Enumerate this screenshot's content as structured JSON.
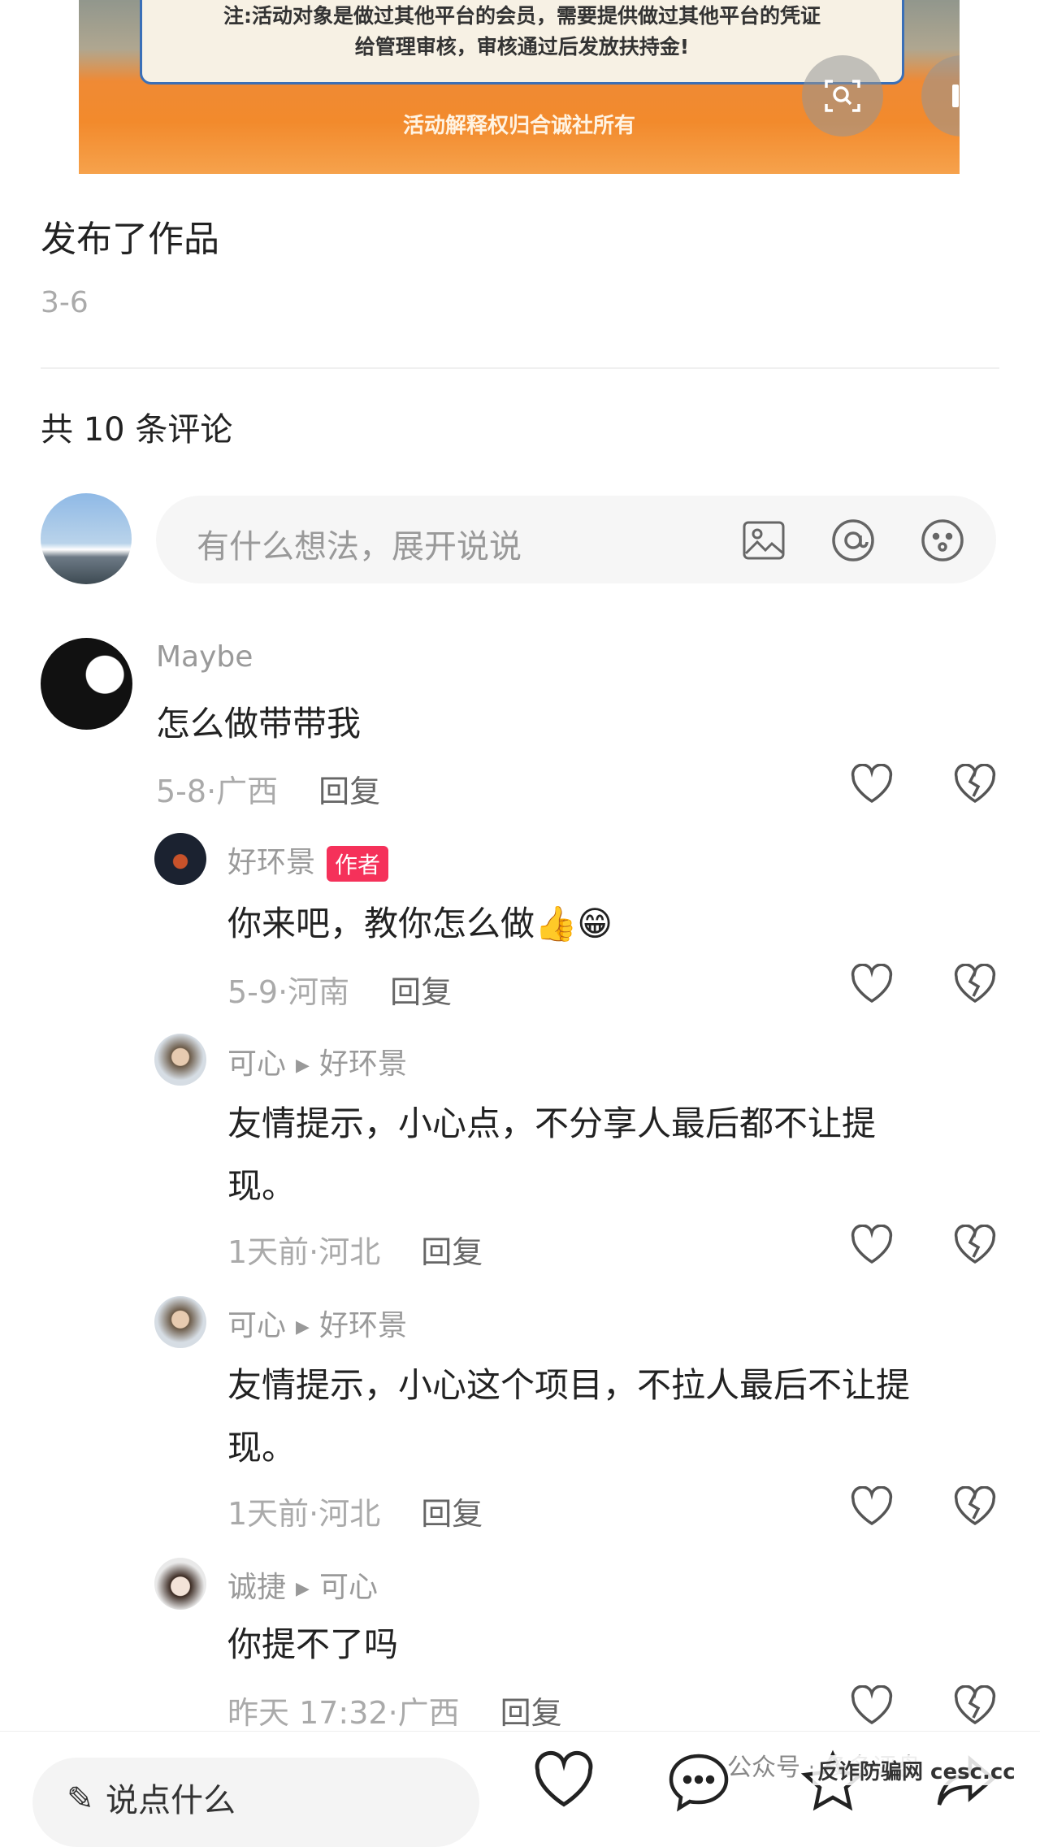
{
  "banner": {
    "notice_line1": "注:活动对象是做过其他平台的会员，需要提供做过其他平台的凭证",
    "notice_line2": "给管理审核，审核通过后发放扶持金!",
    "footer": "活动解释权归合诚社所有"
  },
  "post": {
    "title": "发布了作品",
    "date": "3-6"
  },
  "comments_header": "共 10 条评论",
  "input": {
    "placeholder": "有什么想法，展开说说"
  },
  "comments": [
    {
      "user": "Maybe",
      "text": "怎么做带带我",
      "meta": "5-8·广西",
      "reply": "回复"
    },
    {
      "user": "好环景",
      "badge": "作者",
      "text": "你来吧，教你怎么做👍😁",
      "meta": "5-9·河南",
      "reply": "回复"
    },
    {
      "user": "可心",
      "reply_to": "好环景",
      "text_l1": "友情提示，小心点，不分享人最后都不让提",
      "text_l2": "现。",
      "meta": "1天前·河北",
      "reply": "回复"
    },
    {
      "user": "可心",
      "reply_to": "好环景",
      "text_l1": "友情提示，小心这个项目，不拉人最后不让提",
      "text_l2": "现。",
      "meta": "1天前·河北",
      "reply": "回复"
    },
    {
      "user": "诚捷",
      "reply_to": "可心",
      "text": "你提不了吗",
      "meta": "昨天 17:32·广西",
      "reply": "回复"
    }
  ],
  "bottom_bar": {
    "say_placeholder": "说点什么"
  },
  "watermark": {
    "text1": "公众号 · 多多评盘",
    "text2": "反诈防骗网 cesc.cc"
  }
}
